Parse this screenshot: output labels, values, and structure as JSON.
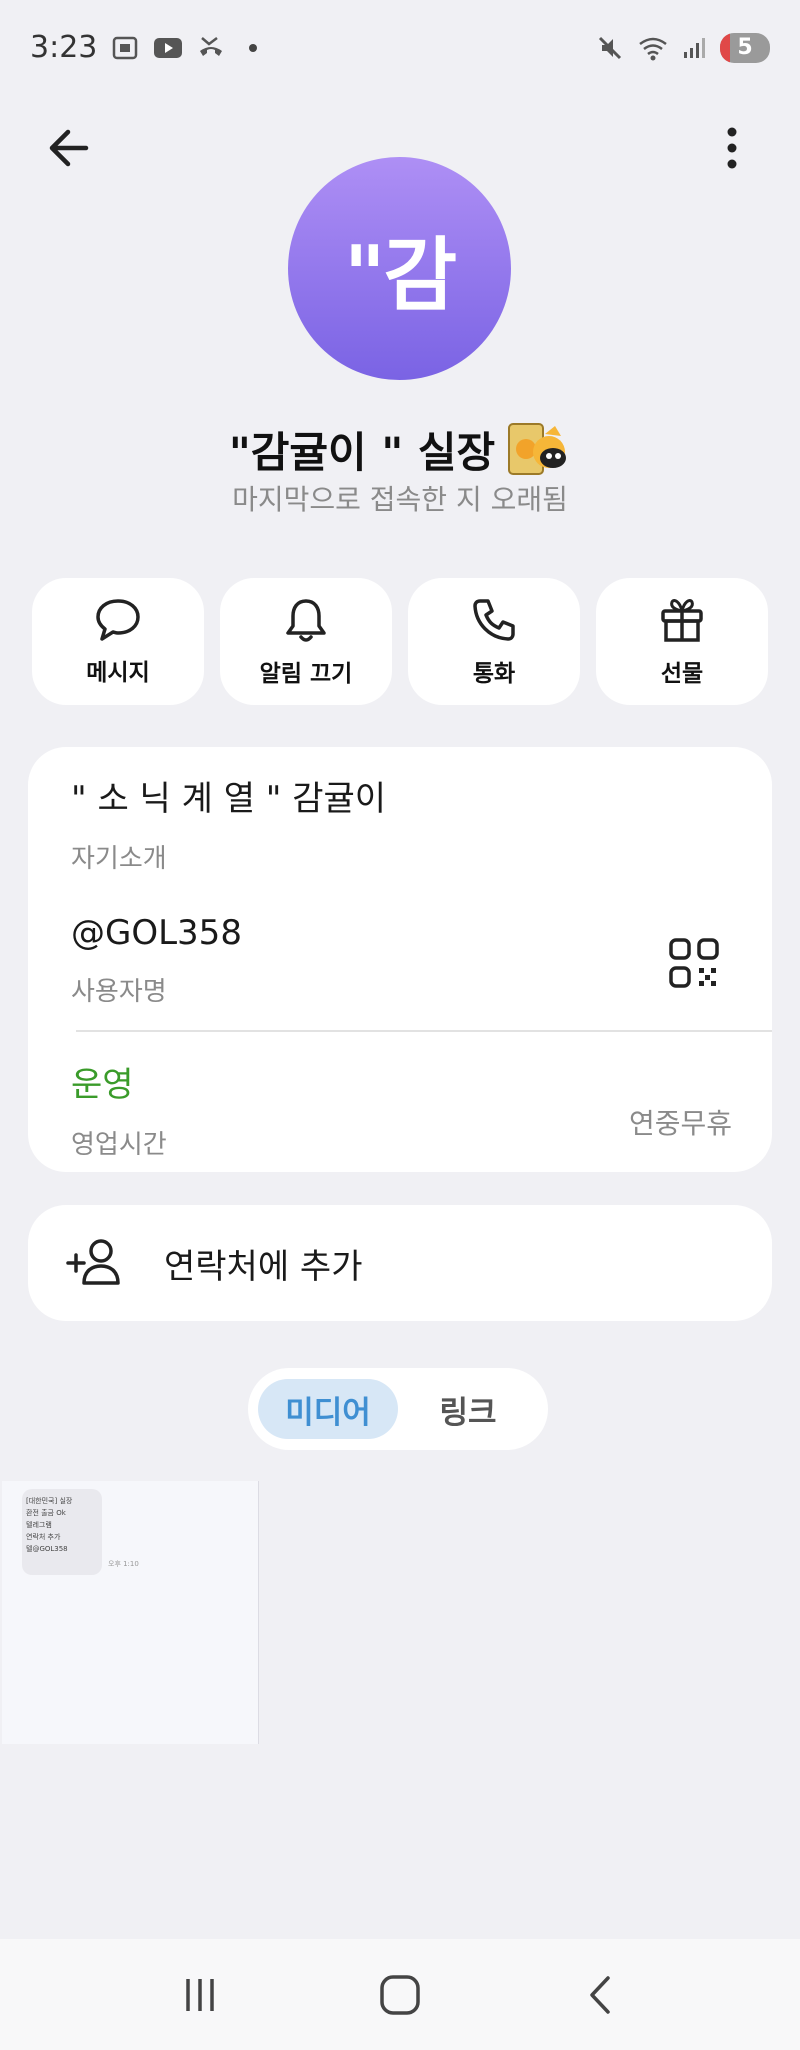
{
  "status_bar": {
    "time": "3:23",
    "battery_level": "5",
    "icons_left": [
      "screenshot-icon",
      "youtube-icon",
      "missed-call-icon",
      "dot-icon"
    ],
    "icons_right": [
      "mute-icon",
      "wifi-icon",
      "signal-icon",
      "battery-icon"
    ]
  },
  "header": {
    "back_icon": "back-arrow-icon",
    "more_icon": "more-vertical-icon"
  },
  "profile": {
    "avatar_text": "\"감",
    "avatar_color": "#8f74ec",
    "name": "\"감귤이 \" 실장",
    "last_seen": "마지막으로 접속한 지 오래됨"
  },
  "actions": [
    {
      "label": "메시지",
      "icon": "message-icon"
    },
    {
      "label": "알림 끄기",
      "icon": "bell-icon"
    },
    {
      "label": "통화",
      "icon": "phone-icon"
    },
    {
      "label": "선물",
      "icon": "gift-icon"
    }
  ],
  "info": {
    "bio_value": "\" 소 닉 계 열 \" 감귤이",
    "bio_label": "자기소개",
    "username_value": "@GOL358",
    "username_label": "사용자명",
    "hours_status": "운영",
    "hours_label": "영업시간",
    "hours_value": "연중무휴",
    "status_color": "#3a9b2a"
  },
  "add_contact": {
    "label": "연락처에 추가",
    "icon": "add-person-icon"
  },
  "tabs": {
    "media": "미디어",
    "links": "링크",
    "active": "media"
  },
  "media_items": [
    {
      "lines": [
        "[대한민국] 실장",
        "환전 출금 Ok",
        "텔레그램",
        "연락처 추가",
        "텔@GOL358"
      ],
      "time": "오후 1:10"
    }
  ]
}
